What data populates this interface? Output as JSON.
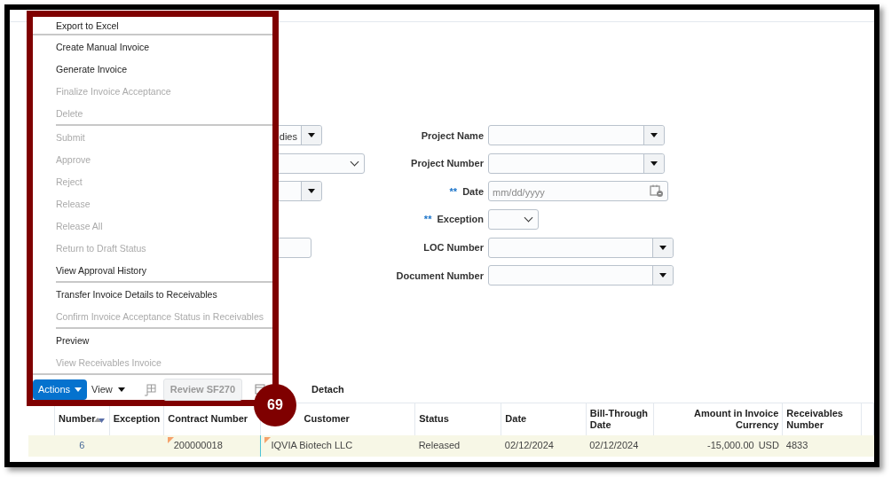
{
  "menu": {
    "groups": [
      [
        {
          "label": "Export to Excel",
          "disabled": false
        }
      ],
      [
        {
          "label": "Create Manual Invoice",
          "disabled": false
        },
        {
          "label": "Generate Invoice",
          "disabled": false
        },
        {
          "label": "Finalize Invoice Acceptance",
          "disabled": true
        },
        {
          "label": "Delete",
          "disabled": true
        }
      ],
      [
        {
          "label": "Submit",
          "disabled": true
        },
        {
          "label": "Approve",
          "disabled": true
        },
        {
          "label": "Reject",
          "disabled": true
        },
        {
          "label": "Release",
          "disabled": true
        },
        {
          "label": "Release All",
          "disabled": true
        },
        {
          "label": "Return to Draft Status",
          "disabled": true
        },
        {
          "label": "View Approval History",
          "disabled": false
        }
      ],
      [
        {
          "label": "Transfer Invoice Details to Receivables",
          "disabled": false
        },
        {
          "label": "Confirm Invoice Acceptance Status in Receivables",
          "disabled": true
        }
      ],
      [
        {
          "label": "Preview",
          "disabled": false
        },
        {
          "label": "View Receivables Invoice",
          "disabled": true
        }
      ]
    ]
  },
  "form": {
    "left_fields": [
      {
        "kind": "combo",
        "value": "dies"
      },
      {
        "kind": "select"
      },
      {
        "kind": "combo"
      },
      {
        "kind": "blank"
      },
      {
        "kind": "text"
      },
      {
        "kind": "blank"
      }
    ],
    "right_fields": [
      {
        "label": "Project Name",
        "kind": "combo"
      },
      {
        "label": "Project Number",
        "kind": "combo"
      },
      {
        "label": "Date",
        "kind": "date",
        "marker": "**",
        "placeholder": "mm/dd/yyyy"
      },
      {
        "label": "Exception",
        "kind": "select",
        "marker": "**"
      },
      {
        "label": "LOC Number",
        "kind": "combo"
      },
      {
        "label": "Document Number",
        "kind": "combo"
      }
    ]
  },
  "toolbar": {
    "actions": "Actions",
    "view": "View",
    "review": {
      "label": "Review SF270",
      "disabled": true
    },
    "detach": "Detach"
  },
  "table": {
    "columns": [
      "Number",
      "Exception",
      "Contract Number",
      "Customer",
      "Status",
      "Date",
      "Bill-Through Date",
      "Amount in Invoice Currency",
      "Receivables Number"
    ],
    "rows": [
      {
        "selected": true,
        "number": "6",
        "contract": "200000018",
        "customer": "IQVIA Biotech LLC",
        "status": "Released",
        "date": "02/12/2024",
        "bill_through": "02/12/2024",
        "amount": "-15,000.00",
        "currency": "USD",
        "receivables": "4833"
      }
    ]
  },
  "callout": "69"
}
